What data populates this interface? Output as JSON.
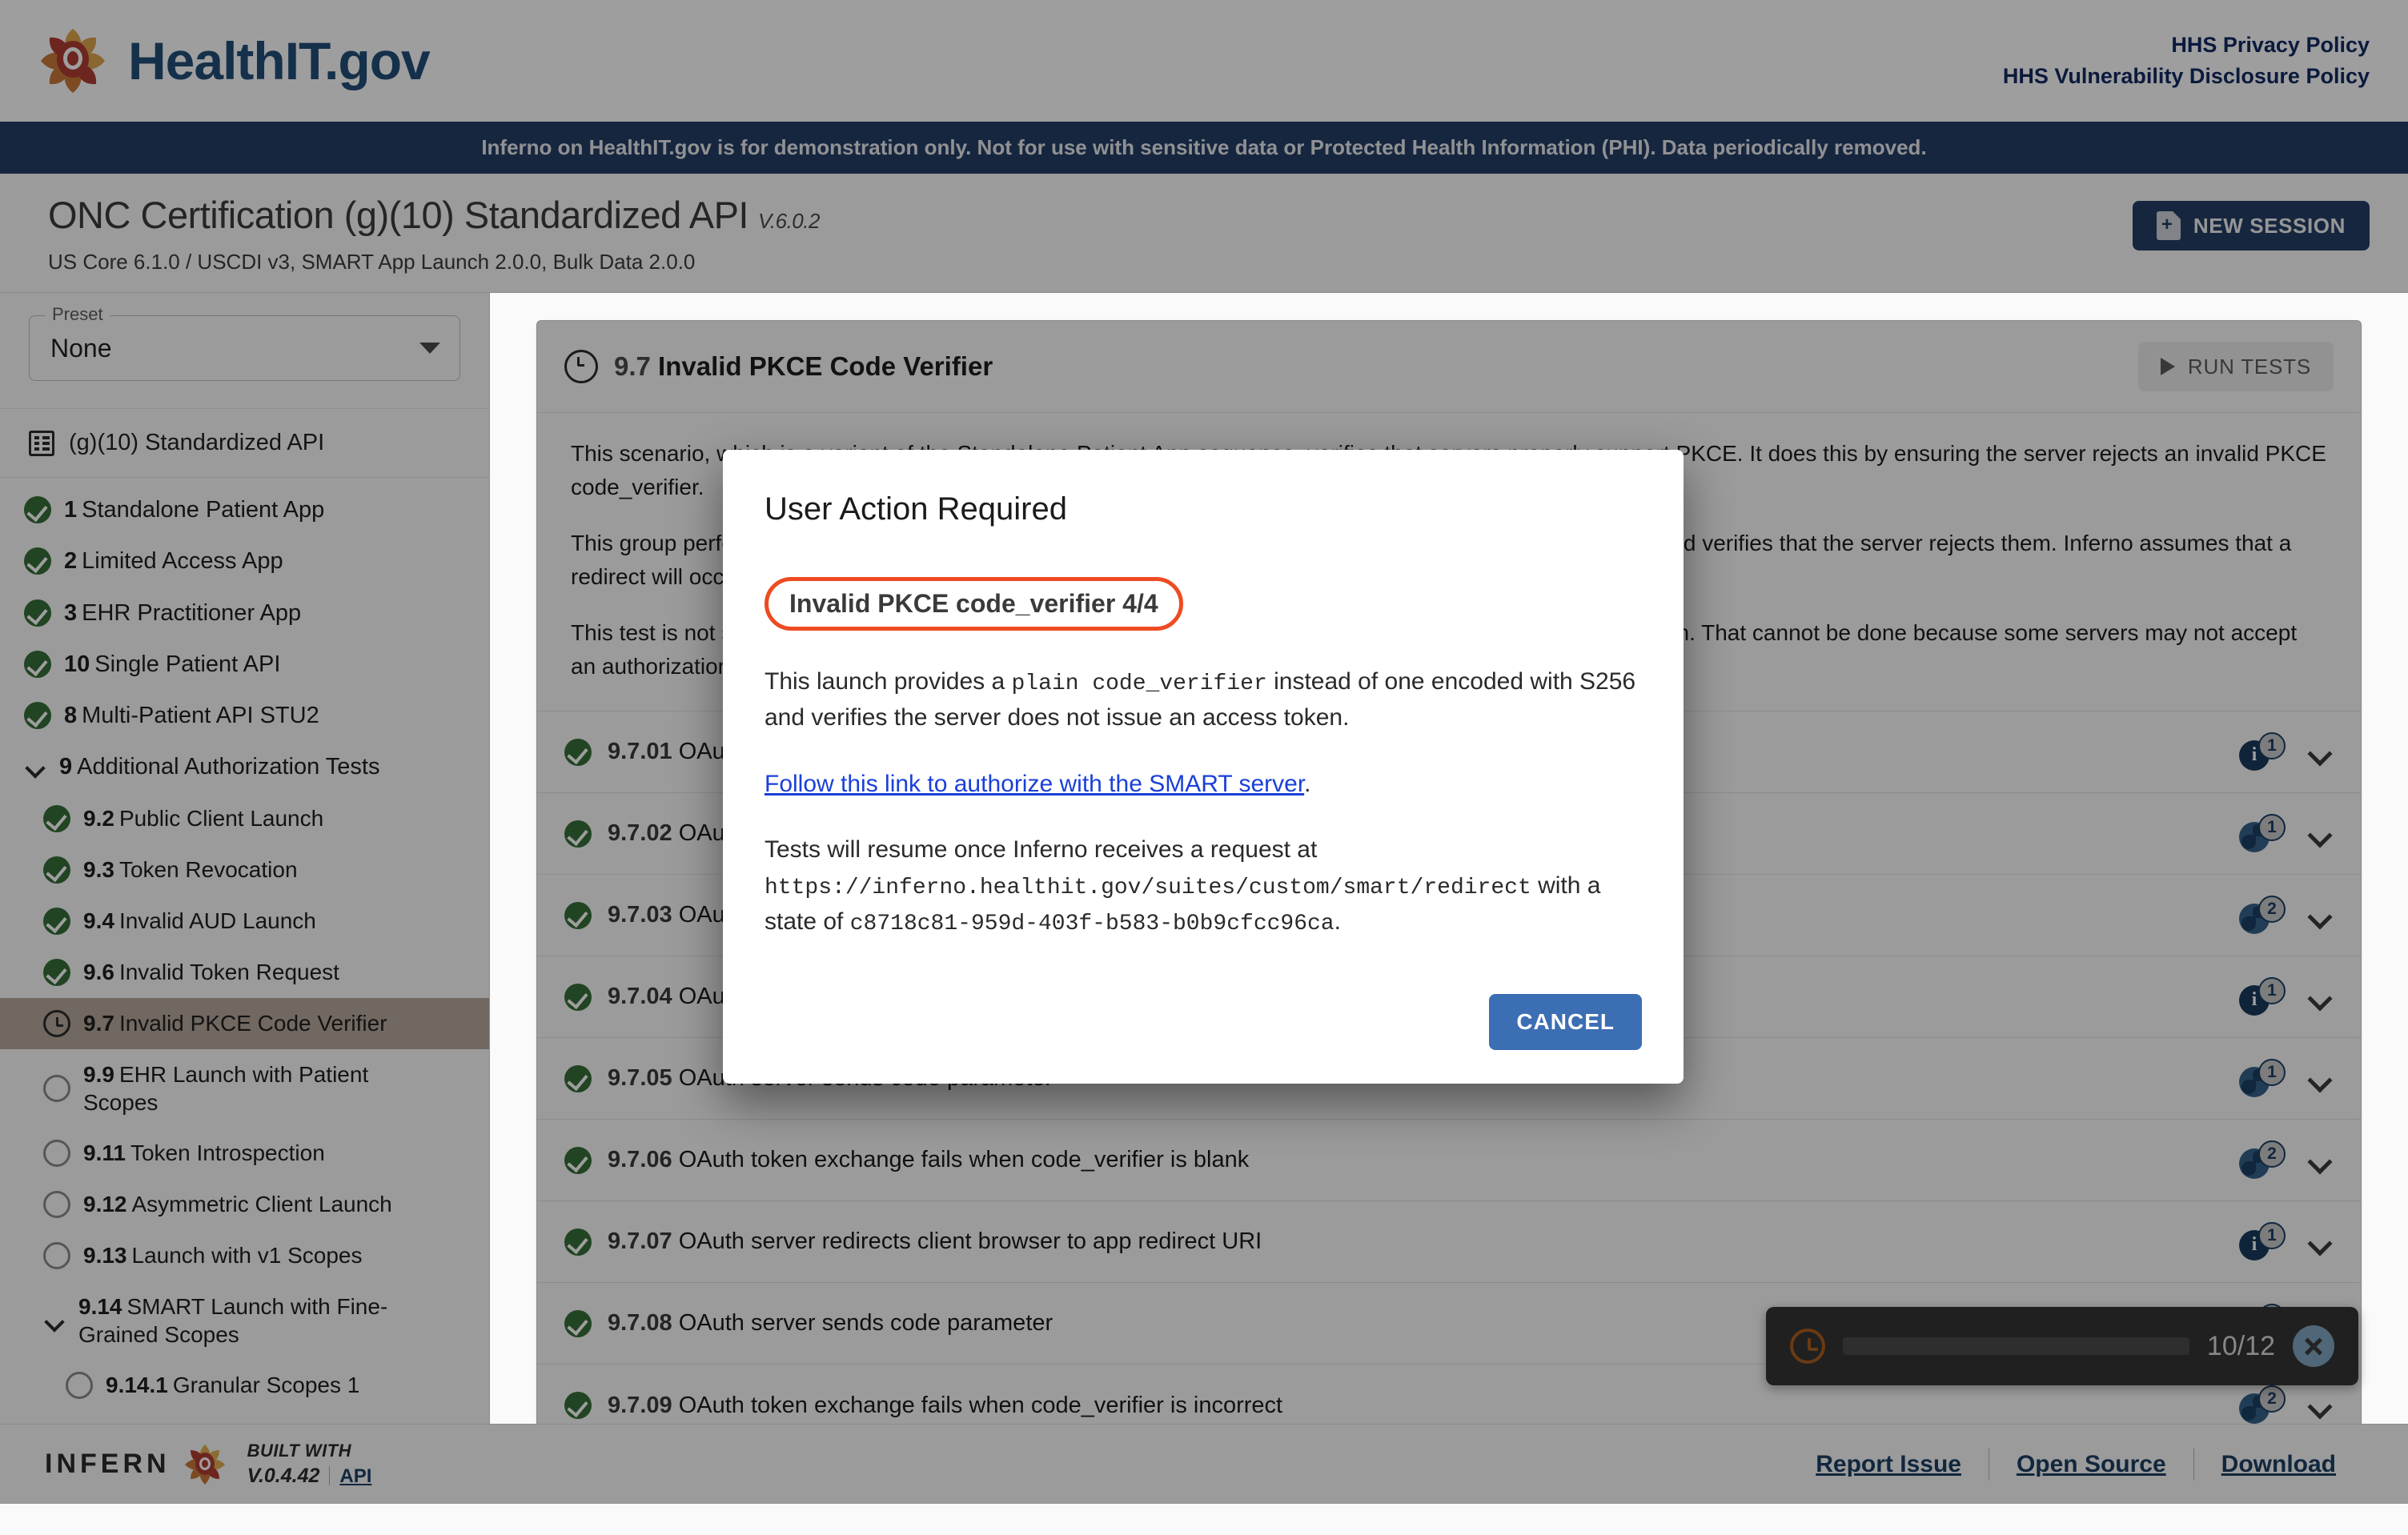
{
  "header": {
    "brand_name": "HealthIT.gov",
    "links": [
      {
        "label": "HHS Privacy Policy"
      },
      {
        "label": "HHS Vulnerability Disclosure Policy"
      }
    ]
  },
  "demo_banner": {
    "text": "Inferno on HealthIT.gov is for demonstration only. Not for use with sensitive data or Protected Health Information (PHI). Data periodically removed."
  },
  "suite": {
    "title": "ONC Certification (g)(10) Standardized API",
    "version": "V.6.0.2",
    "subtitle": "US Core 6.1.0 / USCDI v3, SMART App Launch 2.0.0, Bulk Data 2.0.0",
    "new_session_label": "NEW SESSION"
  },
  "sidebar": {
    "preset_legend": "Preset",
    "preset_value": "None",
    "suite_root_label": "(g)(10) Standardized API",
    "items": [
      {
        "num": "1",
        "label": "Standalone Patient App",
        "status": "pass",
        "level": 1
      },
      {
        "num": "2",
        "label": "Limited Access App",
        "status": "pass",
        "level": 1
      },
      {
        "num": "3",
        "label": "EHR Practitioner App",
        "status": "pass",
        "level": 1
      },
      {
        "num": "10",
        "label": "Single Patient API",
        "status": "pass",
        "level": 1
      },
      {
        "num": "8",
        "label": "Multi-Patient API STU2",
        "status": "pass",
        "level": 1
      },
      {
        "num": "9",
        "label": "Additional Authorization Tests",
        "status": "expanded",
        "level": 1
      },
      {
        "num": "9.2",
        "label": "Public Client Launch",
        "status": "pass",
        "level": 2
      },
      {
        "num": "9.3",
        "label": "Token Revocation",
        "status": "pass",
        "level": 2
      },
      {
        "num": "9.4",
        "label": "Invalid AUD Launch",
        "status": "pass",
        "level": 2
      },
      {
        "num": "9.6",
        "label": "Invalid Token Request",
        "status": "pass",
        "level": 2
      },
      {
        "num": "9.7",
        "label": "Invalid PKCE Code Verifier",
        "status": "wait",
        "level": 2,
        "active": true
      },
      {
        "num": "9.9",
        "label": "EHR Launch with Patient Scopes",
        "status": "idle",
        "level": 2
      },
      {
        "num": "9.11",
        "label": "Token Introspection",
        "status": "idle",
        "level": 2
      },
      {
        "num": "9.12",
        "label": "Asymmetric Client Launch",
        "status": "idle",
        "level": 2
      },
      {
        "num": "9.13",
        "label": "Launch with v1 Scopes",
        "status": "idle",
        "level": 2
      },
      {
        "num": "9.14",
        "label": "SMART Launch with Fine-Grained Scopes",
        "status": "expanded",
        "level": 2
      },
      {
        "num": "9.14.1",
        "label": "Granular Scopes 1",
        "status": "idle",
        "level": 3
      }
    ]
  },
  "panel": {
    "status": "wait",
    "num": "9.7",
    "title": "Invalid PKCE Code Verifier",
    "run_tests_label": "RUN TESTS",
    "description": [
      "This scenario, which is a variant of the Standalone Patient App sequence, verifies that servers properly support PKCE. It does this by ensuring the server rejects an invalid PKCE code_verifier.",
      "This group performs three invalid launches (blank code_verifier, incorrect code_verifier, blank code_identifier) and verifies that the server rejects them. Inferno assumes that a redirect will occur in this test.",
      "This test is not sufficient to infer that PKCE is supported on the server properly without a successful authorization. That cannot be done because some servers may not accept an authorization request."
    ],
    "tests": [
      {
        "num": "9.7.01",
        "label": "OAuth server sends code parameter",
        "status": "pass",
        "badge_type": "info",
        "badge_count": "1"
      },
      {
        "num": "9.7.02",
        "label": "OAuth token exchange fails when code_verifier is blank",
        "status": "pass",
        "badge_type": "globe",
        "badge_count": "1"
      },
      {
        "num": "9.7.03",
        "label": "OAuth server redirects client browser to app redirect URI",
        "status": "pass",
        "badge_type": "globe",
        "badge_count": "2"
      },
      {
        "num": "9.7.04",
        "label": "OAuth server sends code parameter",
        "status": "pass",
        "badge_type": "info",
        "badge_count": "1"
      },
      {
        "num": "9.7.05",
        "label": "OAuth server sends code parameter",
        "status": "pass",
        "badge_type": "globe",
        "badge_count": "1"
      },
      {
        "num": "9.7.06",
        "label": "OAuth token exchange fails when code_verifier is blank",
        "status": "pass",
        "badge_type": "globe",
        "badge_count": "2"
      },
      {
        "num": "9.7.07",
        "label": "OAuth server redirects client browser to app redirect URI",
        "status": "pass",
        "badge_type": "info",
        "badge_count": "1"
      },
      {
        "num": "9.7.08",
        "label": "OAuth server sends code parameter",
        "status": "pass",
        "badge_type": "globe",
        "badge_count": "1"
      },
      {
        "num": "9.7.09",
        "label": "OAuth token exchange fails when code_verifier is incorrect",
        "status": "pass",
        "badge_type": "globe",
        "badge_count": "2"
      }
    ]
  },
  "snackbar": {
    "progress_label": "10/12",
    "progress_percent": 83
  },
  "modal": {
    "title": "User Action Required",
    "chip_label": "Invalid PKCE code_verifier 4/4",
    "para1_a": "This launch provides a ",
    "para1_mono1": "plain code_verifier",
    "para1_b": " instead of one encoded with S256 and verifies the server does not issue an access token.",
    "link_text": "Follow this link to authorize with the SMART server",
    "link_period": ".",
    "para2_a": "Tests will resume once Inferno receives a request at ",
    "para2_url": "https://inferno.healthit.gov/suites/custom/smart/redirect",
    "para2_b": " with a state of ",
    "para2_state": "c8718c81-959d-403f-b583-b0b9cfcc96ca",
    "para2_end": ".",
    "cancel_label": "CANCEL"
  },
  "footer": {
    "brand": "INFERN",
    "built_with": "BUILT WITH",
    "version": "V.0.4.42",
    "api_label": "API",
    "links": [
      {
        "label": "Report Issue"
      },
      {
        "label": "Open Source"
      },
      {
        "label": "Download"
      }
    ]
  }
}
